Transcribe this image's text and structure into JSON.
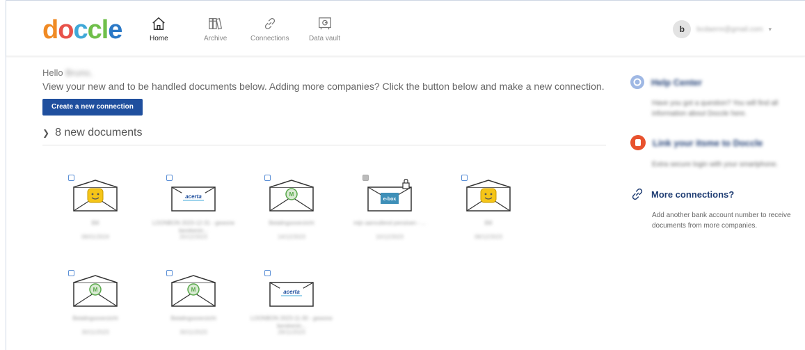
{
  "header": {
    "logo": {
      "l1": "d",
      "l2": "o",
      "l3": "c",
      "l4": "cl",
      "l5": "e"
    },
    "nav": [
      {
        "label": "Home",
        "icon": "home-icon"
      },
      {
        "label": "Archive",
        "icon": "archive-icon"
      },
      {
        "label": "Connections",
        "icon": "link-icon"
      },
      {
        "label": "Data vault",
        "icon": "vault-icon"
      }
    ],
    "user": {
      "initial": "b",
      "email": "bcdaerre@gmail.com"
    }
  },
  "main": {
    "hello_prefix": "Hello",
    "hello_name": "Bruno,",
    "intro": "View your new and to be handled documents below. Adding more companies? Click the button below and make a new connection.",
    "create_button": "Create a new connection",
    "section_title": "8 new documents"
  },
  "documents": [
    {
      "type": "telenet",
      "title": "Bill",
      "date": "08/01/2024",
      "checkbox": "blue"
    },
    {
      "type": "acerta",
      "title": "LOONBON 2023-12-31 - gewone berekenin...",
      "date": "20/12/2023",
      "checkbox": "blue"
    },
    {
      "type": "greenlogo",
      "title": "Betalingsoverzicht",
      "date": "14/12/2023",
      "checkbox": "blue"
    },
    {
      "type": "ebox",
      "title": "mijn aanvullend pensioen - ...",
      "date": "10/12/2023",
      "checkbox": "grey"
    },
    {
      "type": "telenet",
      "title": "Bill",
      "date": "08/12/2023",
      "checkbox": "blue"
    },
    {
      "type": "greenlogo",
      "title": "Betalingsoverzicht",
      "date": "30/11/2023",
      "checkbox": "blue"
    },
    {
      "type": "greenlogo",
      "title": "Betalingsoverzicht",
      "date": "30/11/2023",
      "checkbox": "blue"
    },
    {
      "type": "acerta",
      "title": "LOONBON 2023-11-30 - gewone berekenin...",
      "date": "28/11/2023",
      "checkbox": "blue"
    }
  ],
  "logos": {
    "acerta": "acerta",
    "ebox": "e-box"
  },
  "sidebar": {
    "help": {
      "title": "Help Center",
      "text": "Have you got a question? You will find all information about Doccle here."
    },
    "itsme": {
      "title": "Link your itsme to Doccle",
      "text": "Extra secure login with your smartphone."
    },
    "more": {
      "title": "More connections?",
      "text": "Add another bank account number to receive documents from more companies."
    }
  },
  "colors": {
    "primary": "#1f4f9e",
    "heading": "#1f3d73",
    "telenet": "#f5c518",
    "green": "#58a84a",
    "ebox": "#3e8fb8"
  }
}
